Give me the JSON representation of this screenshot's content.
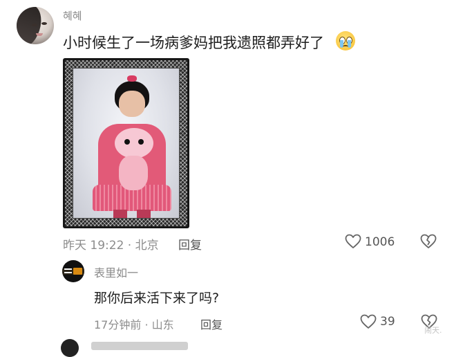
{
  "main_comment": {
    "username": "혜혜",
    "text": "小时候生了一场病爹妈把我遗照都弄好了",
    "emoji": "crying-face-emoji",
    "meta": "昨天 19:22 · 北京",
    "reply_label": "回复",
    "like_count": "1006"
  },
  "reply_comment": {
    "username": "表里如一",
    "text": "那你后来活下来了吗?",
    "meta": "17分钟前 · 山东",
    "reply_label": "回复",
    "like_count": "39"
  },
  "watermark": "闹天.",
  "colors": {
    "text_primary": "#1d1d1d",
    "text_secondary": "#8c8c8c",
    "icon": "#666666"
  },
  "icons": {
    "like": "heart-outline-icon",
    "dislike": "broken-heart-icon"
  }
}
